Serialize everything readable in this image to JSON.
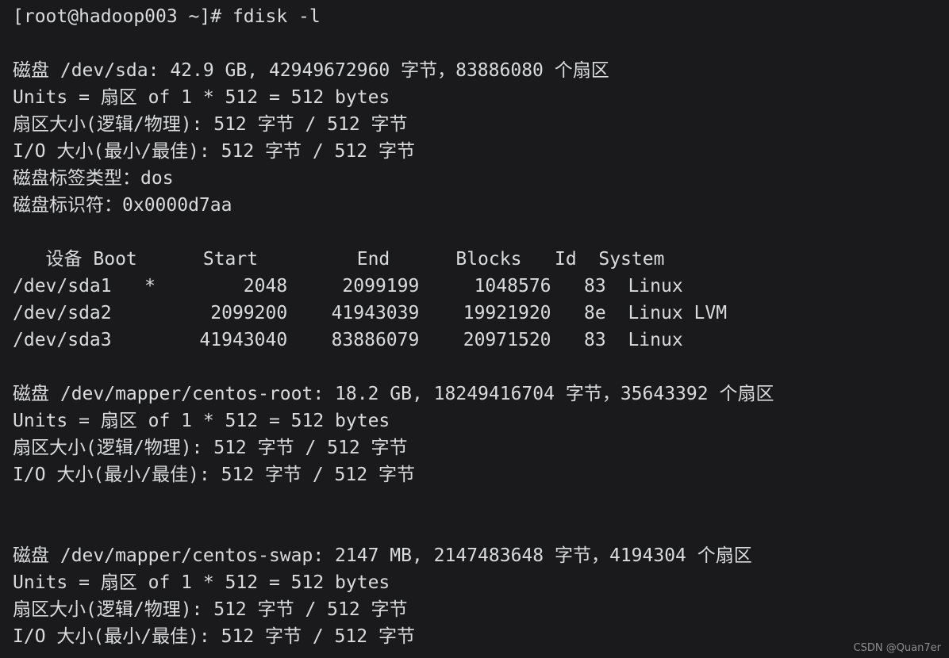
{
  "terminal": {
    "background_color": "#1a1a1c",
    "text_color": "#d9dbde",
    "prompt_line": "[root@hadoop003 ~]# fdisk -l",
    "lines": [
      "[root@hadoop003 ~]# fdisk -l",
      "",
      "磁盘 /dev/sda: 42.9 GB, 42949672960 字节，83886080 个扇区",
      "Units = 扇区 of 1 * 512 = 512 bytes",
      "扇区大小(逻辑/物理): 512 字节 / 512 字节",
      "I/O 大小(最小/最佳): 512 字节 / 512 字节",
      "磁盘标签类型：dos",
      "磁盘标识符：0x0000d7aa",
      "",
      "   设备 Boot      Start         End      Blocks   Id  System",
      "/dev/sda1   *        2048     2099199     1048576   83  Linux",
      "/dev/sda2         2099200    41943039    19921920   8e  Linux LVM",
      "/dev/sda3        41943040    83886079    20971520   83  Linux",
      "",
      "磁盘 /dev/mapper/centos-root: 18.2 GB, 18249416704 字节，35643392 个扇区",
      "Units = 扇区 of 1 * 512 = 512 bytes",
      "扇区大小(逻辑/物理): 512 字节 / 512 字节",
      "I/O 大小(最小/最佳): 512 字节 / 512 字节",
      "",
      "",
      "磁盘 /dev/mapper/centos-swap: 2147 MB, 2147483648 字节，4194304 个扇区",
      "Units = 扇区 of 1 * 512 = 512 bytes",
      "扇区大小(逻辑/物理): 512 字节 / 512 字节",
      "I/O 大小(最小/最佳): 512 字节 / 512 字节"
    ],
    "disks": [
      {
        "device": "/dev/sda",
        "size_human": "42.9 GB",
        "size_bytes": "42949672960",
        "sectors": "83886080",
        "units": "扇区 of 1 * 512 = 512 bytes",
        "sector_size_logical": "512 字节",
        "sector_size_physical": "512 字节",
        "io_size_min": "512 字节",
        "io_size_optimal": "512 字节",
        "label_type": "dos",
        "identifier": "0x0000d7aa"
      },
      {
        "device": "/dev/mapper/centos-root",
        "size_human": "18.2 GB",
        "size_bytes": "18249416704",
        "sectors": "35643392",
        "units": "扇区 of 1 * 512 = 512 bytes",
        "sector_size_logical": "512 字节",
        "sector_size_physical": "512 字节",
        "io_size_min": "512 字节",
        "io_size_optimal": "512 字节"
      },
      {
        "device": "/dev/mapper/centos-swap",
        "size_human": "2147 MB",
        "size_bytes": "2147483648",
        "sectors": "4194304",
        "units": "扇区 of 1 * 512 = 512 bytes",
        "sector_size_logical": "512 字节",
        "sector_size_physical": "512 字节",
        "io_size_min": "512 字节",
        "io_size_optimal": "512 字节"
      }
    ],
    "partition_table": {
      "headers": [
        "设备",
        "Boot",
        "Start",
        "End",
        "Blocks",
        "Id",
        "System"
      ],
      "rows": [
        {
          "device": "/dev/sda1",
          "boot": "*",
          "start": "2048",
          "end": "2099199",
          "blocks": "1048576",
          "id": "83",
          "system": "Linux"
        },
        {
          "device": "/dev/sda2",
          "boot": "",
          "start": "2099200",
          "end": "41943039",
          "blocks": "19921920",
          "id": "8e",
          "system": "Linux LVM"
        },
        {
          "device": "/dev/sda3",
          "boot": "",
          "start": "41943040",
          "end": "83886079",
          "blocks": "20971520",
          "id": "83",
          "system": "Linux"
        }
      ]
    },
    "watermark": "CSDN @Quan7er"
  }
}
